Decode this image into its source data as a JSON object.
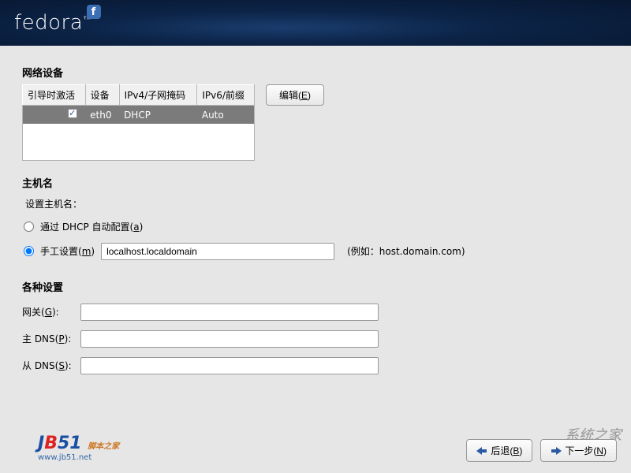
{
  "header": {
    "brand": "fedora"
  },
  "devices": {
    "heading": "网络设备",
    "columns": {
      "active": "引导时激活",
      "device": "设备",
      "ipv4": "IPv4/子网掩码",
      "ipv6": "IPv6/前缀"
    },
    "row": {
      "device": "eth0",
      "ipv4": "DHCP",
      "ipv6": "Auto"
    },
    "edit_label_prefix": "编辑(",
    "edit_accel": "E",
    "edit_label_suffix": ")"
  },
  "hostname": {
    "heading": "主机名",
    "hint": "设置主机名：",
    "dhcp_prefix": "通过  DHCP 自动配置(",
    "dhcp_accel": "a",
    "dhcp_suffix": ")",
    "manual_prefix": "手工设置(",
    "manual_accel": "m",
    "manual_suffix": ")",
    "value": "localhost.localdomain",
    "example": "(例如：host.domain.com)"
  },
  "misc": {
    "heading": "各种设置",
    "gateway_prefix": "网关(",
    "gateway_accel": "G",
    "gateway_suffix": "):",
    "pdns_prefix": "主  DNS(",
    "pdns_accel": "P",
    "pdns_suffix": "):",
    "sdns_prefix": "从  DNS(",
    "sdns_accel": "S",
    "sdns_suffix": "):",
    "gateway_value": "",
    "pdns_value": "",
    "sdns_value": ""
  },
  "footer": {
    "back_prefix": "后退(",
    "back_accel": "B",
    "back_suffix": ")",
    "next_prefix": "下一步(",
    "next_accel": "N",
    "next_suffix": ")",
    "jb_sub": "脚本之家",
    "jb_url": "www.jb51.net"
  },
  "watermark": "系统之家"
}
